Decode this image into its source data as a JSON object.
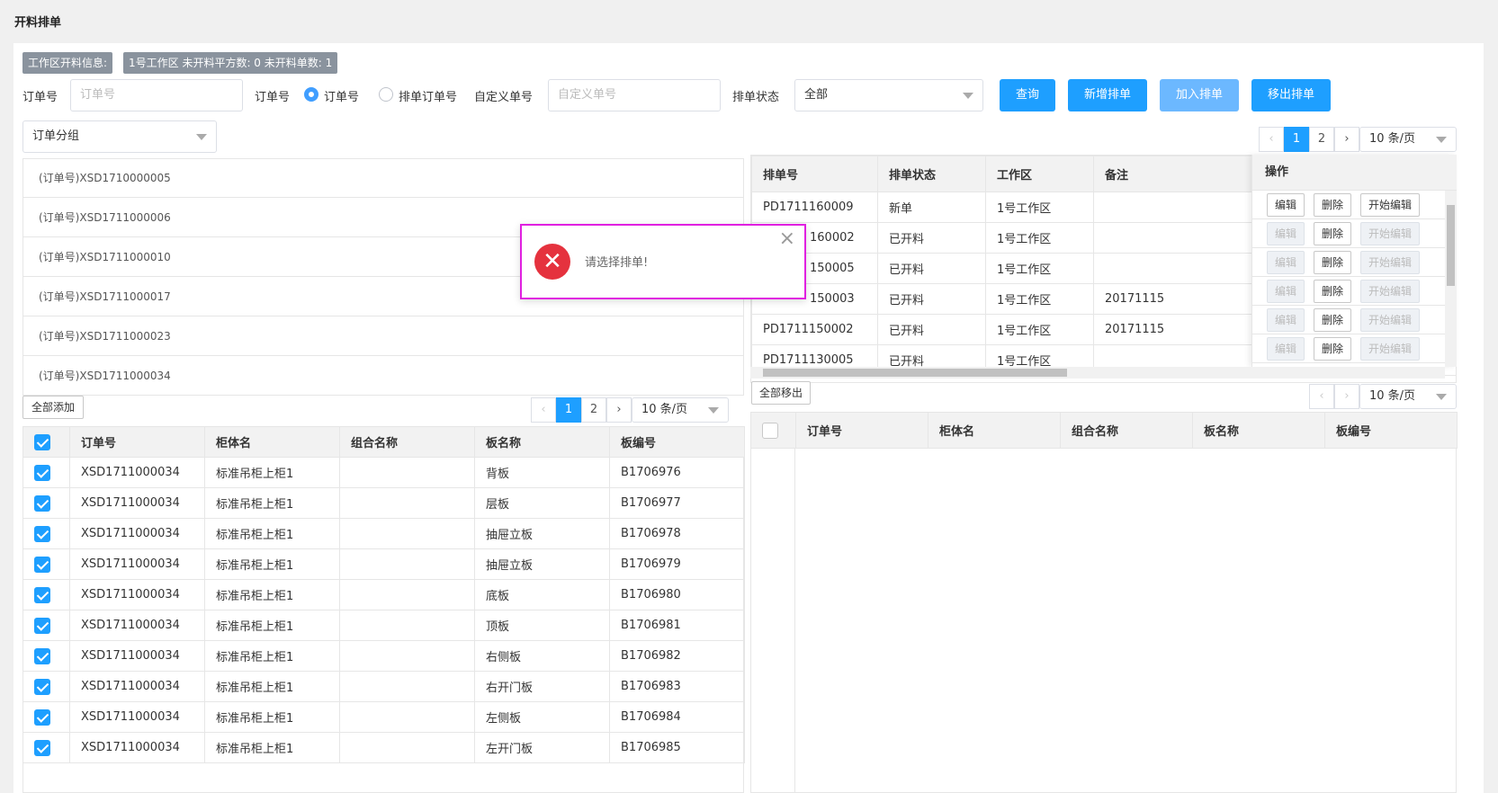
{
  "page_title": "开料排单",
  "info_tags": [
    "工作区开料信息:",
    "1号工作区 未开料平方数: 0 未开料单数: 1"
  ],
  "filters": {
    "order_no_label": "订单号",
    "order_no_placeholder": "订单号",
    "order_type_label": "订单号",
    "radio_order": "订单号",
    "radio_schedule": "排单订单号",
    "custom_label": "自定义单号",
    "custom_placeholder": "自定义单号",
    "status_label": "排单状态",
    "status_value": "全部",
    "group_value": "订单分组"
  },
  "buttons": {
    "query": "查询",
    "add_schedule": "新增排单",
    "join_schedule": "加入排单",
    "remove_schedule": "移出排单",
    "add_all": "全部添加",
    "remove_all": "全部移出"
  },
  "order_groups": [
    "(订单号)XSD1710000005",
    "(订单号)XSD1711000006",
    "(订单号)XSD1711000010",
    "(订单号)XSD1711000017",
    "(订单号)XSD1711000023",
    "(订单号)XSD1711000034"
  ],
  "pagination": {
    "page1": "1",
    "page2": "2",
    "page_size": "10 条/页"
  },
  "schedule_table": {
    "headers": [
      "排单号",
      "排单状态",
      "工作区",
      "备注",
      "操作"
    ],
    "rows": [
      [
        "PD1711160009",
        "新单",
        "1号工作区",
        ""
      ],
      [
        "160002",
        "已开料",
        "1号工作区",
        ""
      ],
      [
        "150005",
        "已开料",
        "1号工作区",
        ""
      ],
      [
        "150003",
        "已开料",
        "1号工作区",
        "20171115"
      ],
      [
        "PD1711150002",
        "已开料",
        "1号工作区",
        "20171115"
      ],
      [
        "PD1711130005",
        "已开料",
        "1号工作区",
        ""
      ]
    ],
    "ops": [
      "编辑",
      "删除",
      "开始编辑"
    ]
  },
  "board_headers": [
    "订单号",
    "柜体名",
    "组合名称",
    "板名称",
    "板编号"
  ],
  "board_rows": [
    [
      "XSD1711000034",
      "标准吊柜上柜1",
      "",
      "背板",
      "B1706976"
    ],
    [
      "XSD1711000034",
      "标准吊柜上柜1",
      "",
      "层板",
      "B1706977"
    ],
    [
      "XSD1711000034",
      "标准吊柜上柜1",
      "",
      "抽屉立板",
      "B1706978"
    ],
    [
      "XSD1711000034",
      "标准吊柜上柜1",
      "",
      "抽屉立板",
      "B1706979"
    ],
    [
      "XSD1711000034",
      "标准吊柜上柜1",
      "",
      "底板",
      "B1706980"
    ],
    [
      "XSD1711000034",
      "标准吊柜上柜1",
      "",
      "顶板",
      "B1706981"
    ],
    [
      "XSD1711000034",
      "标准吊柜上柜1",
      "",
      "右侧板",
      "B1706982"
    ],
    [
      "XSD1711000034",
      "标准吊柜上柜1",
      "",
      "右开门板",
      "B1706983"
    ],
    [
      "XSD1711000034",
      "标准吊柜上柜1",
      "",
      "左侧板",
      "B1706984"
    ],
    [
      "XSD1711000034",
      "标准吊柜上柜1",
      "",
      "左开门板",
      "B1706985"
    ]
  ],
  "toast": {
    "message": "请选择排单!"
  }
}
